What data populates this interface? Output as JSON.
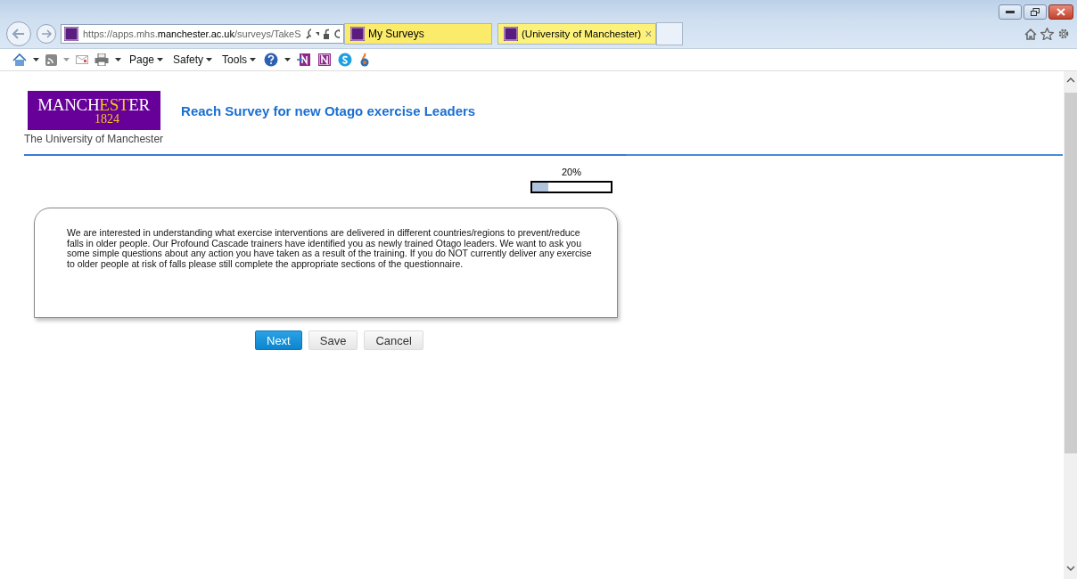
{
  "browser": {
    "address": {
      "prefix": "https://apps.mhs.",
      "domain": "manchester.ac.uk",
      "path": "/surveys/TakeS"
    },
    "tabs": [
      {
        "label": "My Surveys",
        "selected": false,
        "closable": false
      },
      {
        "label": "(University of Manchester)",
        "selected": true,
        "closable": true
      }
    ],
    "close_glyph": "×",
    "menus": [
      "Page",
      "Safety",
      "Tools"
    ]
  },
  "header": {
    "logo": {
      "wordmark": [
        "MANCH",
        "EST",
        "ER"
      ],
      "year": "1824",
      "caption": "The University of Manchester"
    },
    "title": "Reach Survey for new Otago exercise Leaders"
  },
  "progress": {
    "reading": "20%",
    "level": 0.2
  },
  "intro": "We are interested in understanding what exercise interventions are delivered in different countries/regions to prevent/reduce falls in older people. Our Profound Cascade trainers have identified you as newly trained Otago leaders. We want to ask you some simple questions about any action you have taken as a result of the training. If you do NOT currently deliver any exercise to older people at risk of falls please still complete the appropriate sections of the questionnaire.",
  "buttons": [
    {
      "label": "Next",
      "kind": "primary"
    },
    {
      "label": "Save",
      "kind": "secondary"
    },
    {
      "label": "Cancel",
      "kind": "secondary"
    }
  ]
}
